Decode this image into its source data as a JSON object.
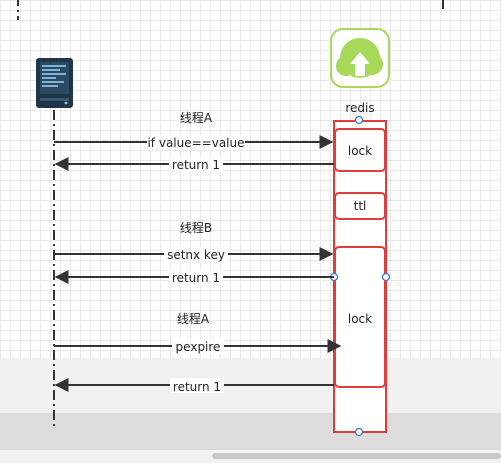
{
  "diagram": {
    "server_icon": "server-icon",
    "redis_icon": "redis-cloud-icon",
    "redis_label": "redis",
    "messages": [
      {
        "title": "线程A",
        "label": "if value==value",
        "direction": "to-redis"
      },
      {
        "label": "return 1",
        "direction": "to-client"
      },
      {
        "title": "线程B",
        "label": "setnx key",
        "direction": "to-redis"
      },
      {
        "label": "return 1",
        "direction": "to-client"
      },
      {
        "title": "线程A",
        "label": "pexpire",
        "direction": "to-redis"
      },
      {
        "label": "return 1",
        "direction": "to-client"
      }
    ],
    "blocks": [
      {
        "label": "lock"
      },
      {
        "label": "ttl"
      },
      {
        "label": "lock"
      }
    ]
  },
  "colors": {
    "activation_border": "#e23b3b",
    "redis_icon": "#a6d85a",
    "lifeline": "#333333",
    "handle": "#3d78c8"
  }
}
